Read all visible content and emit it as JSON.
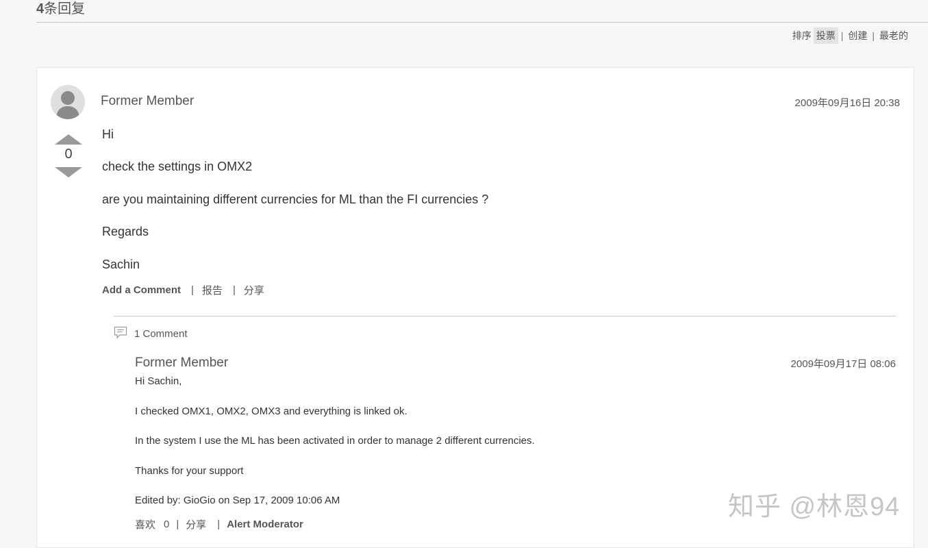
{
  "header": {
    "reply_count": "4",
    "reply_label": "条回复"
  },
  "sort": {
    "label": "排序",
    "options": [
      "投票",
      "创建",
      "最老的"
    ],
    "active": "投票"
  },
  "answer": {
    "author": "Former Member",
    "timestamp": "2009年09月16日 20:38",
    "votes": "0",
    "lines": [
      "Hi",
      "check the settings in OMX2",
      "are you maintaining different currencies for ML than the FI currencies ?",
      "Regards",
      "Sachin"
    ],
    "actions": {
      "add_comment": "Add a Comment",
      "report": "报告",
      "share": "分享"
    }
  },
  "comments": {
    "count_label": "1 Comment",
    "items": [
      {
        "author": "Former Member",
        "timestamp": "2009年09月17日 08:06",
        "lines": [
          "Hi Sachin,",
          "I checked OMX1, OMX2, OMX3 and everything is linked ok.",
          "In the system I use the ML has been activated in order to manage 2 different currencies.",
          "Thanks for your support",
          "Edited by: GioGio on Sep 17, 2009 10:06 AM"
        ],
        "like_label": "喜欢",
        "like_count": "0",
        "share_label": "分享",
        "alert_label": "Alert Moderator"
      }
    ]
  },
  "watermark": "知乎 @林恩94",
  "icons": {
    "avatar": "user-avatar-icon",
    "vote_up": "triangle-up-icon",
    "vote_down": "triangle-down-icon",
    "comment": "speech-bubble-icon"
  },
  "colors": {
    "background": "#f7f7f7",
    "card": "#ffffff",
    "text": "#333333",
    "muted": "#555555",
    "vote": "#999999"
  }
}
